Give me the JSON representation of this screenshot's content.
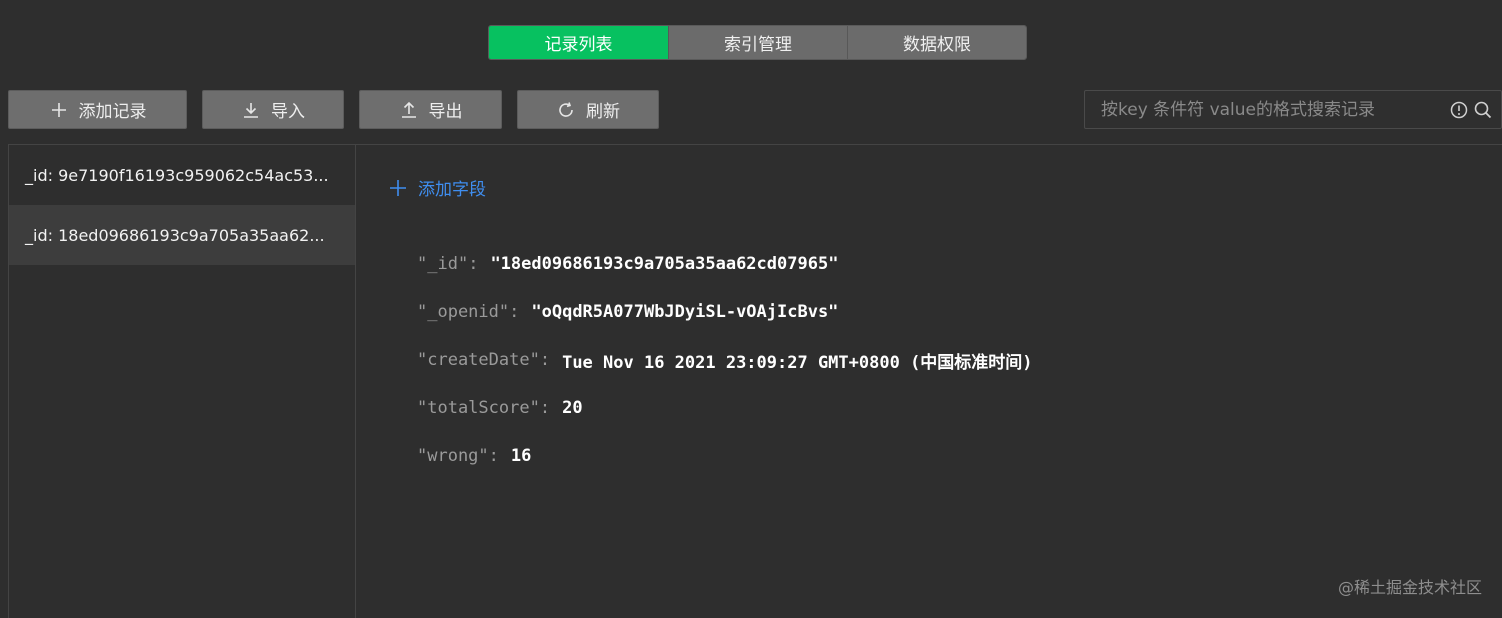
{
  "tabs": [
    {
      "label": "记录列表",
      "active": true
    },
    {
      "label": "索引管理",
      "active": false
    },
    {
      "label": "数据权限",
      "active": false
    }
  ],
  "toolbar": {
    "add_record": {
      "label": "添加记录",
      "icon": "plus-icon"
    },
    "import": {
      "label": "导入",
      "icon": "download-icon"
    },
    "export": {
      "label": "导出",
      "icon": "upload-icon"
    },
    "refresh": {
      "label": "刷新",
      "icon": "refresh-icon"
    }
  },
  "search": {
    "placeholder": "按key 条件符 value的格式搜索记录",
    "icons": [
      "info-icon",
      "search-icon"
    ]
  },
  "records": [
    {
      "label": "_id: 9e7190f16193c959062c54ac53...",
      "selected": false
    },
    {
      "label": "_id: 18ed09686193c9a705a35aa62...",
      "selected": true
    }
  ],
  "detail": {
    "add_field_label": "添加字段",
    "fields": [
      {
        "key": "\"_id\"",
        "value": "\"18ed09686193c9a705a35aa62cd07965\""
      },
      {
        "key": "\"_openid\"",
        "value": "\"oQqdR5A077WbJDyiSL-vOAjIcBvs\""
      },
      {
        "key": "\"createDate\"",
        "value": "Tue Nov 16 2021 23:09:27 GMT+0800 (中国标准时间)"
      },
      {
        "key": "\"totalScore\"",
        "value": "20"
      },
      {
        "key": "\"wrong\"",
        "value": "16"
      }
    ]
  },
  "watermark": "@稀土掘金技术社区",
  "colors": {
    "accent": "#07c160",
    "link": "#3f8ef0",
    "background": "#2e2e2e"
  }
}
